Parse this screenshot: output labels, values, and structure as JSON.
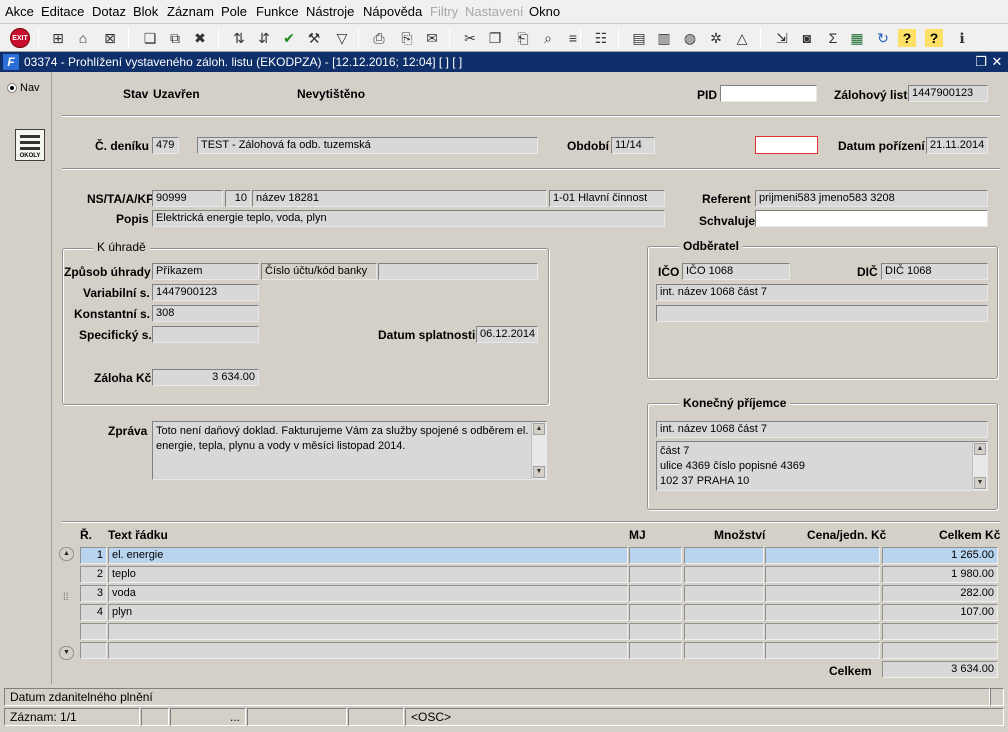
{
  "menu": [
    {
      "label": "Akce",
      "enabled": true
    },
    {
      "label": "Editace",
      "enabled": true
    },
    {
      "label": "Dotaz",
      "enabled": true
    },
    {
      "label": "Blok",
      "enabled": true
    },
    {
      "label": "Záznam",
      "enabled": true
    },
    {
      "label": "Pole",
      "enabled": true
    },
    {
      "label": "Funkce",
      "enabled": true
    },
    {
      "label": "Nástroje",
      "enabled": true
    },
    {
      "label": "Nápověda",
      "enabled": true
    },
    {
      "label": "Filtry",
      "enabled": false
    },
    {
      "label": "Nastavení",
      "enabled": false
    },
    {
      "label": "Okno",
      "enabled": true
    }
  ],
  "toolbar": {
    "exit_label": "EXIT",
    "icons": [
      "exit-icon",
      "add-record-icon",
      "save-record-icon",
      "delete-record-icon",
      "copy-record-icon",
      "duplicate-icon",
      "clear-icon",
      "sort-asc-icon",
      "sort-desc-icon",
      "checkmark-icon",
      "wrench-icon",
      "filter-icon",
      "print-icon",
      "print-preview-icon",
      "email-icon",
      "cut-icon",
      "copy-icon",
      "paste-icon",
      "find-icon",
      "list-icon",
      "tree-icon",
      "document-icon",
      "document2-icon",
      "globe-icon",
      "gear-icon",
      "chart-icon",
      "export-icon",
      "camera-icon",
      "sum-icon",
      "excel-icon",
      "refresh-icon",
      "help-icon",
      "help2-icon",
      "info-icon"
    ]
  },
  "window": {
    "title": "03374 - Prohlížení vystaveného záloh. listu (EKODPZA) - [12.12.2016; 12:04] [ ] [ ]",
    "logo": "F"
  },
  "nav": {
    "label": "Nav",
    "okoly_label": "OKOLY"
  },
  "header": {
    "stav_label": "Stav",
    "stav_value": "Uzavřen",
    "print_status": "Nevytištěno",
    "pid_label": "PID",
    "pid_value": "",
    "zaloh_label": "Zálohový list",
    "zaloh_value": "1447900123"
  },
  "row2": {
    "denik_label": "Č. deníku",
    "denik_code": "479",
    "denik_name": "TEST - Zálohová fa odb. tuzemská",
    "obdobi_label": "Období",
    "obdobi_value": "11/14",
    "focus_value": "",
    "datum_label": "Datum pořízení",
    "datum_value": "21.11.2014"
  },
  "row3": {
    "ns_label": "NS/TA/A/KP",
    "ns": "90999",
    "ta": "10",
    "a": "název 18281",
    "kp": "1-01 Hlavní činnost",
    "referent_label": "Referent",
    "referent_value": "prijmeni583 jmeno583 3208",
    "popis_label": "Popis",
    "popis_value": "Elektrická energie teplo, voda, plyn",
    "schvaluje_label": "Schvaluje",
    "schvaluje_value": ""
  },
  "k_uhrade": {
    "title": "K úhradě",
    "zpusob_label": "Způsob úhrady",
    "zpusob_value": "Příkazem",
    "ucet_label": "Číslo účtu/kód banky",
    "ucet_value": "",
    "var_label": "Variabilní s.",
    "var_value": "1447900123",
    "konst_label": "Konstantní s.",
    "konst_value": "308",
    "spec_label": "Specifický s.",
    "spec_value": "",
    "splatnost_label": "Datum splatnosti",
    "splatnost_value": "06.12.2014",
    "zaloha_label": "Záloha Kč",
    "zaloha_value": "3 634.00"
  },
  "odberatel": {
    "title": "Odběratel",
    "ico_label": "IČO",
    "ico_value": "IČO 1068",
    "dic_label": "DIČ",
    "dic_value": "DIČ 1068",
    "name_value": "int. název 1068 část 7",
    "extra_value": ""
  },
  "zprava": {
    "label": "Zpráva",
    "lines": [
      "Toto není daňový doklad. Fakturujeme Vám za služby spojené s odběrem el.",
      "energie, tepla, plynu a vody v měsíci listopad 2014."
    ]
  },
  "prijemce": {
    "title": "Konečný příjemce",
    "name_value": "int. název 1068 část 7",
    "address_lines": [
      "část 7",
      "ulice 4369 číslo popisné 4369",
      "102 37 PRAHA 10"
    ]
  },
  "table": {
    "headers": {
      "r": "Ř.",
      "text": "Text řádku",
      "mj": "MJ",
      "mnozstvi": "Množství",
      "cena": "Cena/jedn. Kč",
      "celkem": "Celkem Kč"
    },
    "rows": [
      {
        "r": "1",
        "text": "el. energie",
        "mj": "",
        "mnozstvi": "",
        "cena": "",
        "celkem": "1 265.00"
      },
      {
        "r": "2",
        "text": "teplo",
        "mj": "",
        "mnozstvi": "",
        "cena": "",
        "celkem": "1 980.00"
      },
      {
        "r": "3",
        "text": "voda",
        "mj": "",
        "mnozstvi": "",
        "cena": "",
        "celkem": "282.00"
      },
      {
        "r": "4",
        "text": "plyn",
        "mj": "",
        "mnozstvi": "",
        "cena": "",
        "celkem": "107.00"
      },
      {
        "r": "",
        "text": "",
        "mj": "",
        "mnozstvi": "",
        "cena": "",
        "celkem": ""
      },
      {
        "r": "",
        "text": "",
        "mj": "",
        "mnozstvi": "",
        "cena": "",
        "celkem": ""
      }
    ],
    "total_label": "Celkem",
    "total_value": "3 634.00"
  },
  "statusbar": {
    "hint": "Datum zdanitelného plnění",
    "record": "Záznam: 1/1",
    "dots": "...",
    "mode": "<OSC>"
  }
}
